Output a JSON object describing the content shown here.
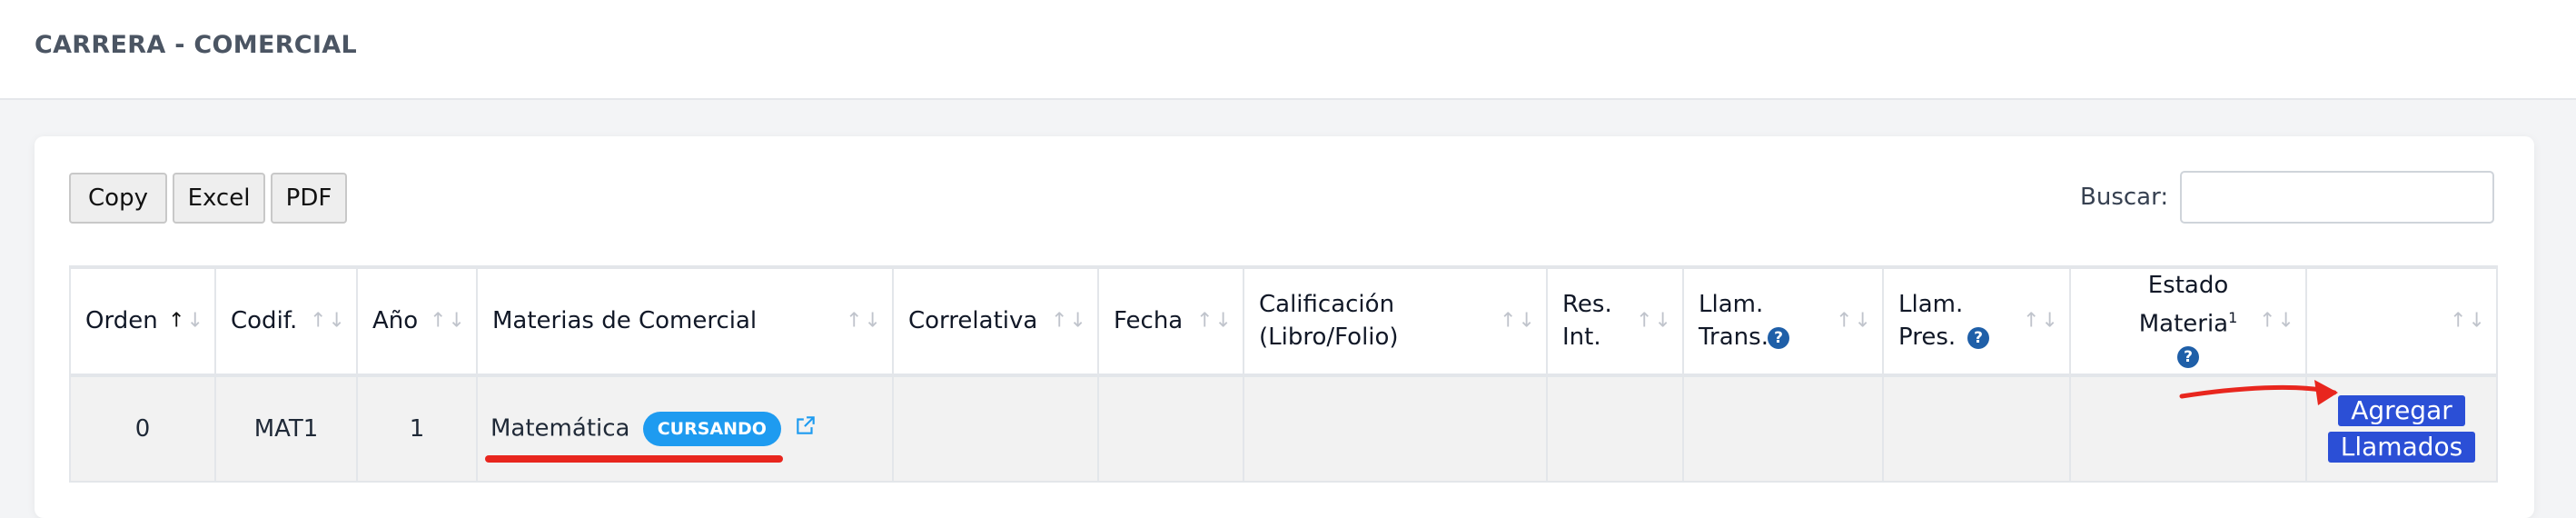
{
  "header": {
    "title": "CARRERA - COMERCIAL"
  },
  "toolbar": {
    "buttons": [
      {
        "label": "Copy"
      },
      {
        "label": "Excel"
      },
      {
        "label": "PDF"
      }
    ],
    "search_label": "Buscar:",
    "search_value": "",
    "search_placeholder": ""
  },
  "table": {
    "columns": [
      {
        "label": "Orden"
      },
      {
        "label": "Codif."
      },
      {
        "label": "Año"
      },
      {
        "label": "Materias de Comercial"
      },
      {
        "label": "Correlativa"
      },
      {
        "label": "Fecha"
      },
      {
        "label": "Calificación (Libro/Folio)"
      },
      {
        "label": "Res. Int."
      },
      {
        "label": "Llam. Trans."
      },
      {
        "label": "Llam. Pres."
      },
      {
        "label": "Estado Materia",
        "superscript": "1"
      },
      {
        "label": ""
      }
    ],
    "sorted_column": "Orden",
    "sorted_direction": "ascending",
    "rows": [
      {
        "orden": "0",
        "codif": "MAT1",
        "anio": "1",
        "materia": "Matemática",
        "status_badge": "CURSANDO",
        "correlativa": "",
        "fecha": "",
        "calificacion": "",
        "res_int": "",
        "llam_trans": "",
        "llam_pres": "",
        "estado_materia": "",
        "action_line1": "Agregar",
        "action_line2": "Llamados"
      }
    ]
  },
  "icons": {
    "sort": "sort-arrows-icon",
    "help": "question-circle-icon",
    "open": "external-link-icon"
  },
  "colors": {
    "badge": "#1e9bf0",
    "action_button": "#2b4fd6",
    "help_icon": "#1f5fa8",
    "annotation": "#e8261e"
  }
}
